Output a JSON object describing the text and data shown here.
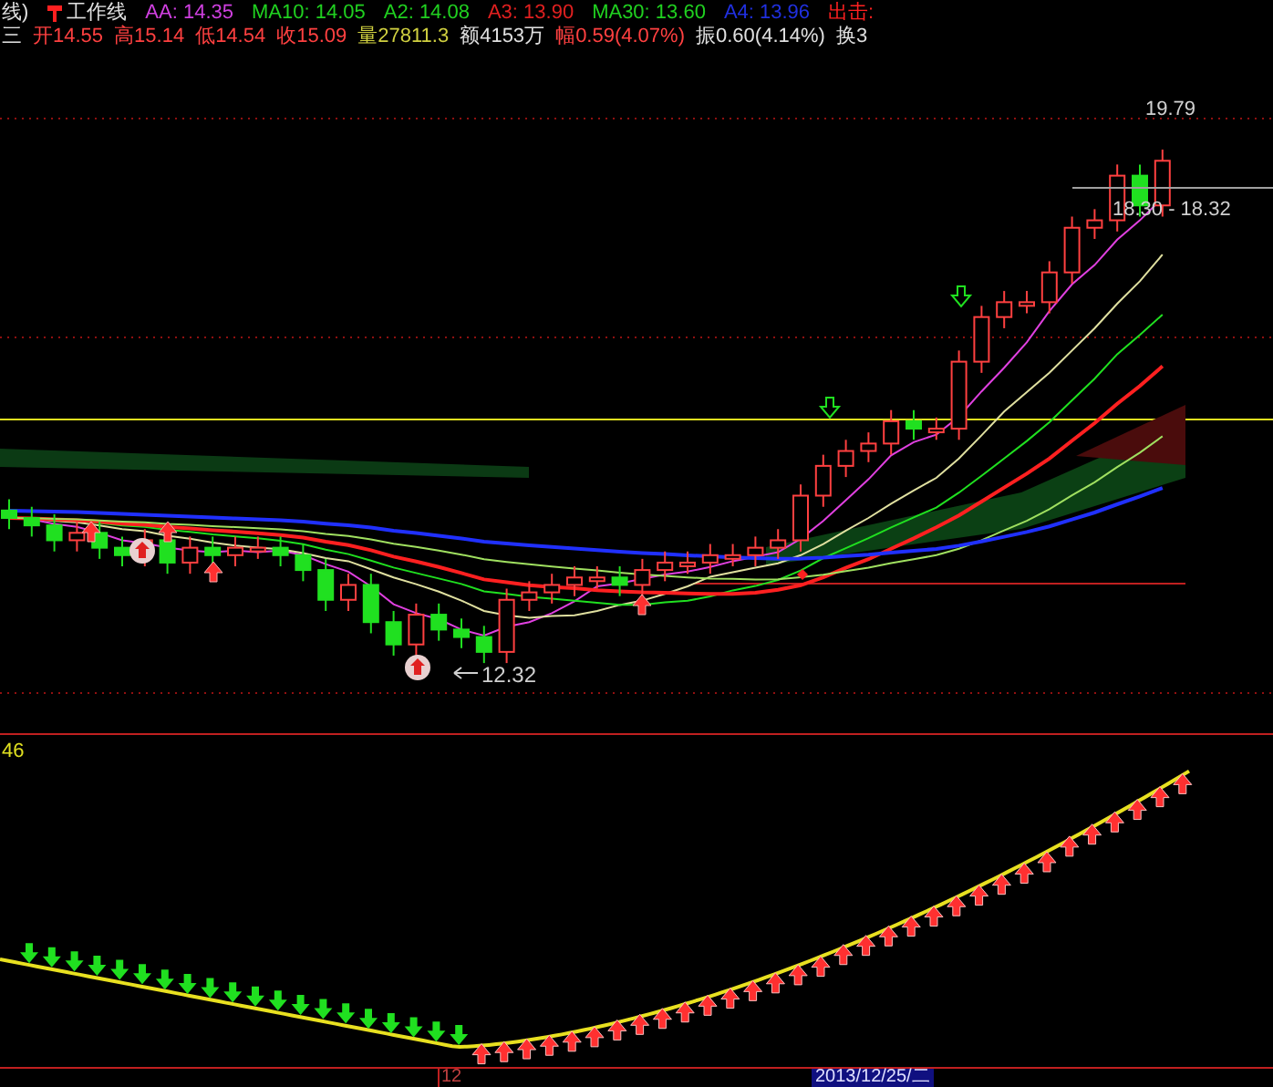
{
  "header": {
    "title_left": "线)",
    "formula_name": "工作线",
    "indicators": [
      {
        "label": "AA: 14.35",
        "color": "#d040e0"
      },
      {
        "label": "MA10: 14.05",
        "color": "#20d020"
      },
      {
        "label": "A2: 14.08",
        "color": "#20d020"
      },
      {
        "label": "A3: 13.90",
        "color": "#e02020"
      },
      {
        "label": "MA30: 13.60",
        "color": "#20d020"
      },
      {
        "label": "A4: 13.96",
        "color": "#2030e0"
      },
      {
        "label": "出击:",
        "color": "#ff2020"
      }
    ]
  },
  "quote": {
    "lead": "三",
    "fields": [
      {
        "label": "开",
        "value": "14.55",
        "color": "#ff4040"
      },
      {
        "label": "高",
        "value": "15.14",
        "color": "#ff4040"
      },
      {
        "label": "低",
        "value": "14.54",
        "color": "#ff4040"
      },
      {
        "label": "收",
        "value": "15.09",
        "color": "#ff4040"
      },
      {
        "label": "量",
        "value": "27811.3",
        "color": "#d0d040"
      },
      {
        "label": "额",
        "value": "4153万",
        "color": "#e0e0e0"
      },
      {
        "label": "幅",
        "value": "0.59(4.07%)",
        "color": "#ff4040"
      },
      {
        "label": "振",
        "value": "0.60(4.14%)",
        "color": "#e0e0e0"
      },
      {
        "label": "换",
        "value": "3",
        "color": "#e0e0e0"
      }
    ]
  },
  "main_chart": {
    "labels": [
      "19.79",
      "18.30 - 18.32",
      "12.32"
    ]
  },
  "sub_chart": {
    "value": "46"
  },
  "axis": {
    "tick": "12",
    "date": "2013/12/25/二"
  }
}
